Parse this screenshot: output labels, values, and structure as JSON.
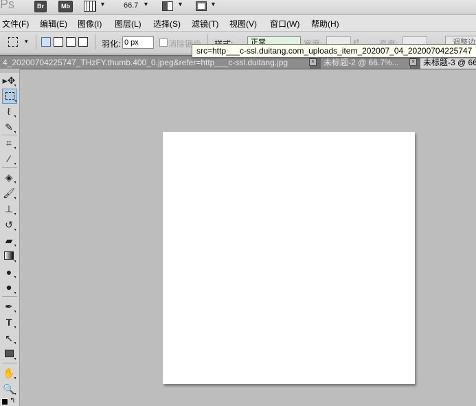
{
  "app": {
    "logo": "Ps",
    "bridge_badge": "Br",
    "minibridge_badge": "Mb",
    "zoom_value": "66.7"
  },
  "menu": {
    "items": [
      "文件(F)",
      "编辑(E)",
      "图像(I)",
      "图层(L)",
      "选择(S)",
      "滤镜(T)",
      "视图(V)",
      "窗口(W)",
      "帮助(H)"
    ]
  },
  "options": {
    "feather_label": "羽化:",
    "feather_value": "0 px",
    "anti_alias_label": "消除锯齿",
    "style_label": "样式:",
    "style_value": "正常",
    "width_label": "宽度:",
    "height_label": "高度:",
    "refine_edge_label": "调整边"
  },
  "tooltip": {
    "text": "src=http___c-ssl.duitang.com_uploads_item_202007_04_20200704225747"
  },
  "tabs": [
    {
      "label": "4_20200704225747_THzFY.thumb.400_0.jpeg&refer=http___c-ssl.duitang.jpg",
      "active": false
    },
    {
      "label": "未标题-2 @ 66.7%...",
      "active": false
    },
    {
      "label": "未标题-3 @ 66",
      "active": true
    }
  ],
  "tools": [
    "move-tool",
    "rectangular-marquee-tool",
    "lasso-tool",
    "quick-selection-tool",
    "crop-tool",
    "eyedropper-tool",
    "spot-healing-brush-tool",
    "brush-tool",
    "clone-stamp-tool",
    "history-brush-tool",
    "eraser-tool",
    "gradient-tool",
    "blur-tool",
    "dodge-tool",
    "pen-tool",
    "type-tool",
    "path-selection-tool",
    "rectangle-tool",
    "hand-tool",
    "zoom-tool"
  ],
  "colors": {
    "workspace": "#bdbdbd",
    "menubar": "#e3e3e3",
    "tab_active": "#d9d9d9",
    "tool_selected": "#b6cde6",
    "canvas": "#ffffff"
  }
}
